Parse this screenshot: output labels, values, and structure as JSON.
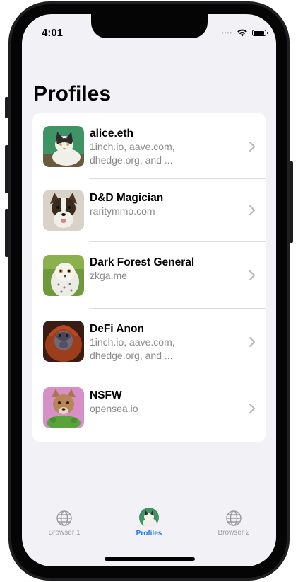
{
  "status": {
    "time": "4:01"
  },
  "page": {
    "title": "Profiles"
  },
  "profiles": [
    {
      "name": "alice.eth",
      "sites_line1": "1inch.io, aave.com,",
      "sites_line2": "dhedge.org, and ...",
      "avatar": "cat-icon"
    },
    {
      "name": "D&D Magician",
      "sites_line1": "raritymmo.com",
      "sites_line2": "",
      "avatar": "dog-icon"
    },
    {
      "name": "Dark Forest General",
      "sites_line1": "zkga.me",
      "sites_line2": "",
      "avatar": "owl-icon"
    },
    {
      "name": "DeFi Anon",
      "sites_line1": "1inch.io, aave.com,",
      "sites_line2": "dhedge.org, and ...",
      "avatar": "orangutan-icon"
    },
    {
      "name": "NSFW",
      "sites_line1": "opensea.io",
      "sites_line2": "",
      "avatar": "dog-icon"
    }
  ],
  "tabbar": {
    "tabs": [
      {
        "label": "Browser 1",
        "icon": "globe-icon",
        "active": false
      },
      {
        "label": "Profiles",
        "icon": "avatar-icon",
        "active": true
      },
      {
        "label": "Browser 2",
        "icon": "globe-icon",
        "active": false
      }
    ]
  },
  "colors": {
    "accent": "#1a7ae6",
    "background": "#f2f1f6",
    "secondary_text": "#8a8a8e"
  }
}
